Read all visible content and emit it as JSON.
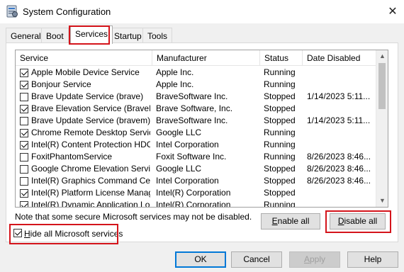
{
  "window": {
    "title": "System Configuration",
    "close_glyph": "✕",
    "icon": "msconfig-icon"
  },
  "tabs": [
    {
      "label": "General",
      "active": false
    },
    {
      "label": "Boot",
      "active": false
    },
    {
      "label": "Services",
      "active": true
    },
    {
      "label": "Startup",
      "active": false
    },
    {
      "label": "Tools",
      "active": false
    }
  ],
  "services_list": {
    "columns": [
      "Service",
      "Manufacturer",
      "Status",
      "Date Disabled"
    ],
    "rows": [
      {
        "checked": true,
        "service": "Apple Mobile Device Service",
        "manufacturer": "Apple Inc.",
        "status": "Running",
        "date_disabled": ""
      },
      {
        "checked": true,
        "service": "Bonjour Service",
        "manufacturer": "Apple Inc.",
        "status": "Running",
        "date_disabled": ""
      },
      {
        "checked": false,
        "service": "Brave Update Service (brave)",
        "manufacturer": "BraveSoftware Inc.",
        "status": "Stopped",
        "date_disabled": "1/14/2023 5:11..."
      },
      {
        "checked": true,
        "service": "Brave Elevation Service (BraveEl...",
        "manufacturer": "Brave Software, Inc.",
        "status": "Stopped",
        "date_disabled": ""
      },
      {
        "checked": false,
        "service": "Brave Update Service (bravem)",
        "manufacturer": "BraveSoftware Inc.",
        "status": "Stopped",
        "date_disabled": "1/14/2023 5:11..."
      },
      {
        "checked": true,
        "service": "Chrome Remote Desktop Service",
        "manufacturer": "Google LLC",
        "status": "Running",
        "date_disabled": ""
      },
      {
        "checked": true,
        "service": "Intel(R) Content Protection HDC...",
        "manufacturer": "Intel Corporation",
        "status": "Running",
        "date_disabled": ""
      },
      {
        "checked": false,
        "service": "FoxitPhantomService",
        "manufacturer": "Foxit Software Inc.",
        "status": "Running",
        "date_disabled": "8/26/2023 8:46..."
      },
      {
        "checked": false,
        "service": "Google Chrome Elevation Servic...",
        "manufacturer": "Google LLC",
        "status": "Stopped",
        "date_disabled": "8/26/2023 8:46..."
      },
      {
        "checked": false,
        "service": "Intel(R) Graphics Command Cen...",
        "manufacturer": "Intel Corporation",
        "status": "Stopped",
        "date_disabled": "8/26/2023 8:46..."
      },
      {
        "checked": true,
        "service": "Intel(R) Platform License Manag...",
        "manufacturer": "Intel(R) Corporation",
        "status": "Stopped",
        "date_disabled": ""
      },
      {
        "checked": true,
        "service": "Intel(R) Dynamic Application Loa...",
        "manufacturer": "Intel(R) Corporation",
        "status": "Running",
        "date_disabled": ""
      }
    ],
    "scroll_up_glyph": "▲",
    "scroll_down_glyph": "▼"
  },
  "note": "Note that some secure Microsoft services may not be disabled.",
  "buttons": {
    "enable_all": {
      "mnemonic": "E",
      "rest": "nable all"
    },
    "disable_all": {
      "mnemonic": "D",
      "rest": "isable all"
    },
    "ok": "OK",
    "cancel": "Cancel",
    "apply": {
      "mnemonic": "A",
      "rest": "pply"
    },
    "help": "Help"
  },
  "hide_ms": {
    "checked": true,
    "mnemonic": "H",
    "rest": "ide all Microsoft services"
  },
  "colors": {
    "highlight_red": "#d4141b",
    "default_button_border": "#0078d7"
  }
}
